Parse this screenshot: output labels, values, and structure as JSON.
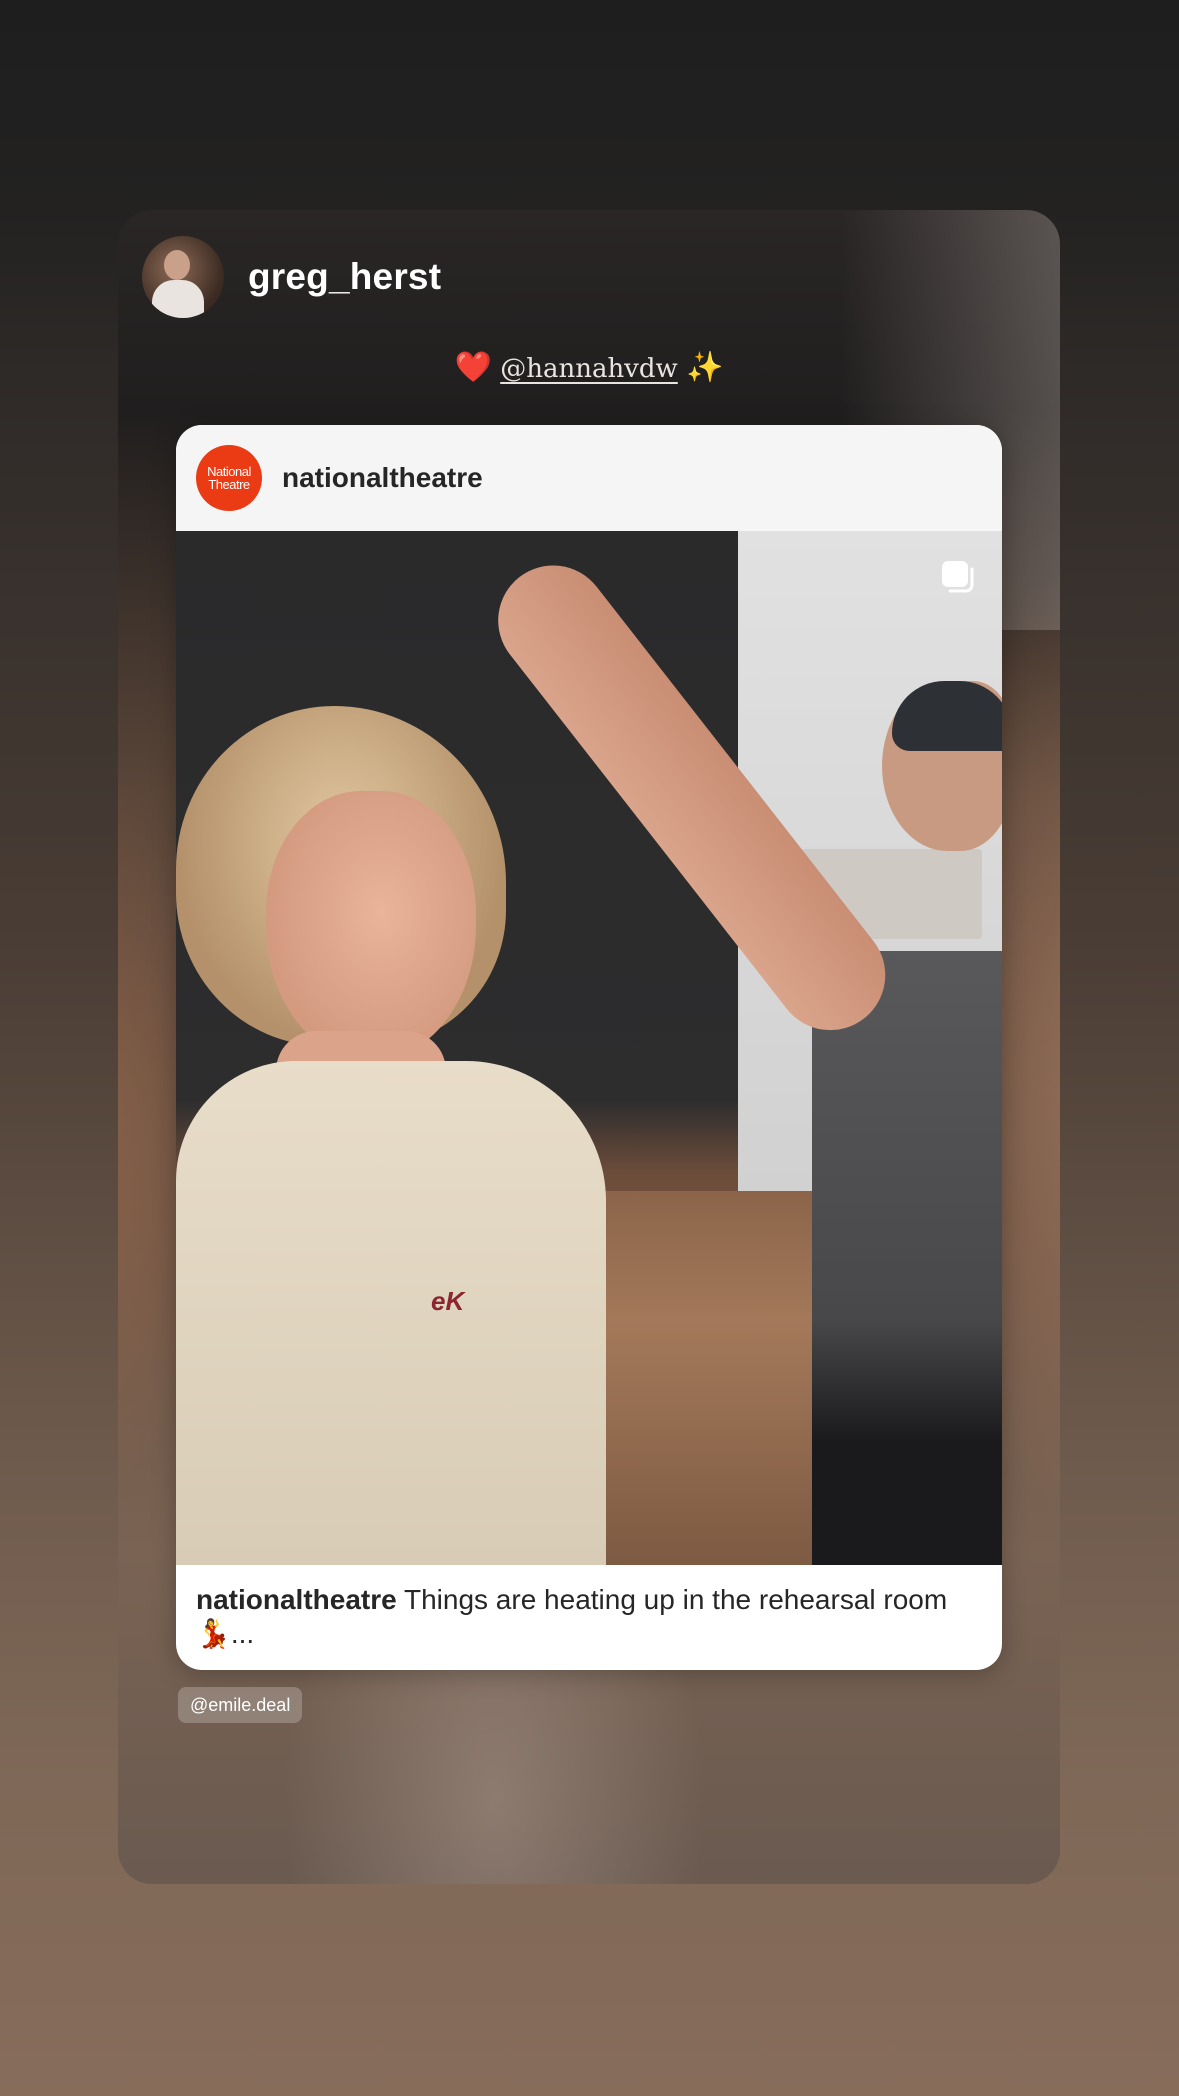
{
  "story": {
    "username": "greg_herst",
    "caption": {
      "heart": "❤️",
      "mention": "@hannahvdw",
      "sparkle": "✨"
    }
  },
  "shared_post": {
    "account": "nationaltheatre",
    "logo_text_line1": "National",
    "logo_text_line2": "Theatre",
    "logo_color": "#ea3b14",
    "media_icon": "multiple-images-icon",
    "caption_account": "nationaltheatre",
    "caption_text": " Things are heating up in the rehearsal room 💃...",
    "shirt_logo": "eK"
  },
  "mention_tag": "@emile.deal"
}
